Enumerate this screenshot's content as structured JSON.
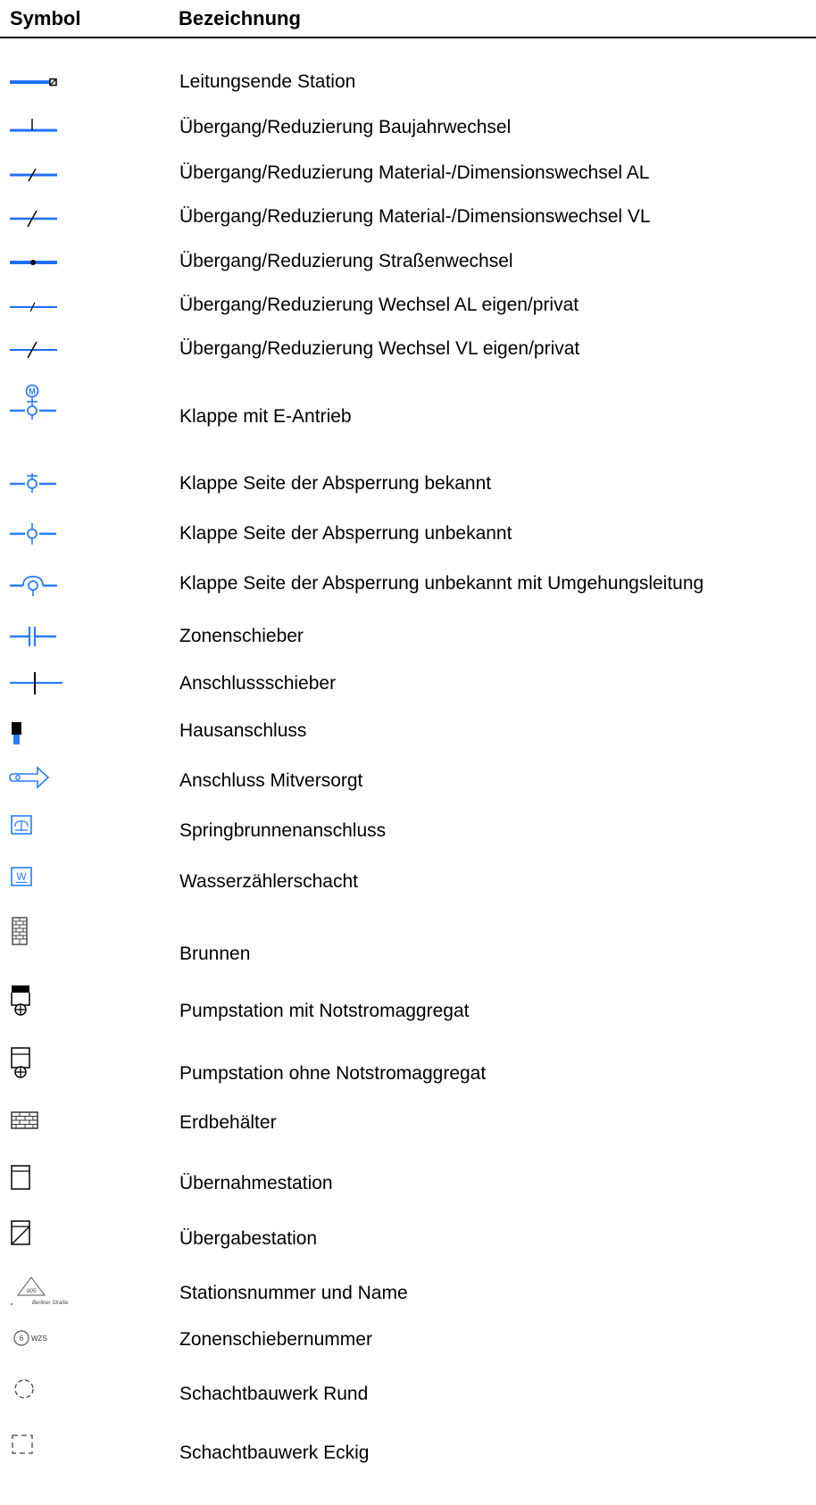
{
  "header": {
    "symbol_col": "Symbol",
    "name_col": "Bezeichnung"
  },
  "colors": {
    "line_blue": "#1f6fff",
    "icon_blue": "#2a7bff",
    "gray": "#555555",
    "black": "#000000"
  },
  "rows": [
    {
      "icon": "line-end-station-icon",
      "label": "Leitungsende Station"
    },
    {
      "icon": "construction-year-change-icon",
      "label": "Übergang/Reduzierung Baujahrwechsel"
    },
    {
      "icon": "material-change-al-icon",
      "label": "Übergang/Reduzierung Material-/Dimensionswechsel AL"
    },
    {
      "icon": "material-change-vl-icon",
      "label": "Übergang/Reduzierung Material-/Dimensionswechsel VL"
    },
    {
      "icon": "street-change-icon",
      "label": "Übergang/Reduzierung Straßenwechsel"
    },
    {
      "icon": "al-own-private-change-icon",
      "label": "Übergang/Reduzierung Wechsel AL eigen/privat"
    },
    {
      "icon": "vl-own-private-change-icon",
      "label": "Übergang/Reduzierung Wechsel VL eigen/privat"
    },
    {
      "icon": "valve-electric-drive-icon",
      "label": "Klappe mit E-Antrieb"
    },
    {
      "icon": "valve-side-known-icon",
      "label": "Klappe Seite der Absperrung bekannt"
    },
    {
      "icon": "valve-side-unknown-icon",
      "label": "Klappe Seite der Absperrung unbekannt"
    },
    {
      "icon": "valve-bypass-icon",
      "label": "Klappe Seite der Absperrung unbekannt mit Umgehungsleitung"
    },
    {
      "icon": "zone-gate-valve-icon",
      "label": "Zonenschieber"
    },
    {
      "icon": "connection-gate-valve-icon",
      "label": "Anschlussschieber"
    },
    {
      "icon": "house-connection-icon",
      "label": "Hausanschluss"
    },
    {
      "icon": "co-supplied-connection-icon",
      "label": "Anschluss Mitversorgt"
    },
    {
      "icon": "fountain-connection-icon",
      "label": "Springbrunnenanschluss"
    },
    {
      "icon": "water-meter-shaft-icon",
      "label": "Wasserzählerschacht"
    },
    {
      "icon": "well-icon",
      "label": "Brunnen"
    },
    {
      "icon": "pump-station-emergency-power-icon",
      "label": "Pumpstation mit Notstromaggregat"
    },
    {
      "icon": "pump-station-no-emergency-power-icon",
      "label": "Pumpstation ohne Notstromaggregat"
    },
    {
      "icon": "ground-tank-icon",
      "label": "Erdbehälter"
    },
    {
      "icon": "takeover-station-icon",
      "label": "Übernahmestation"
    },
    {
      "icon": "handover-station-icon",
      "label": "Übergabestation"
    },
    {
      "icon": "station-number-name-icon",
      "label": "Stationsnummer und Name",
      "icon_text": {
        "number": "005",
        "name": "Berliner Straße"
      }
    },
    {
      "icon": "zone-gate-number-icon",
      "label": "Zonenschiebernummer",
      "icon_text": {
        "number": "6",
        "code": "WZS"
      }
    },
    {
      "icon": "manhole-round-icon",
      "label": "Schachtbauwerk Rund"
    },
    {
      "icon": "manhole-square-icon",
      "label": "Schachtbauwerk Eckig"
    }
  ]
}
